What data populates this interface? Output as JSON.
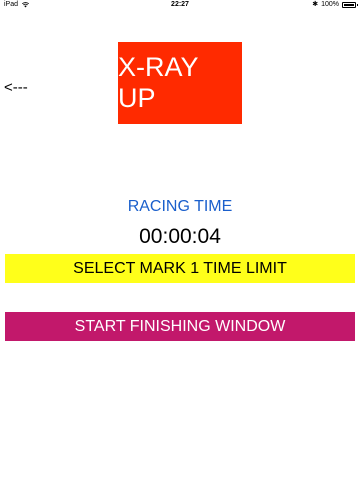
{
  "status_bar": {
    "device": "iPad",
    "time": "22:27",
    "battery": "100%",
    "battery_level": 1.0
  },
  "nav": {
    "back_label": "<---"
  },
  "flag": {
    "label": "X-RAY UP",
    "color": "#ff2a00"
  },
  "race": {
    "label": "RACING TIME",
    "time": "00:00:04"
  },
  "buttons": {
    "mark_limit": "SELECT MARK 1 TIME LIMIT",
    "finishing_window": "START FINISHING WINDOW"
  },
  "colors": {
    "label_blue": "#1a5fcc",
    "mark_yellow": "#ffff1a",
    "finish_magenta": "#c2186b"
  }
}
